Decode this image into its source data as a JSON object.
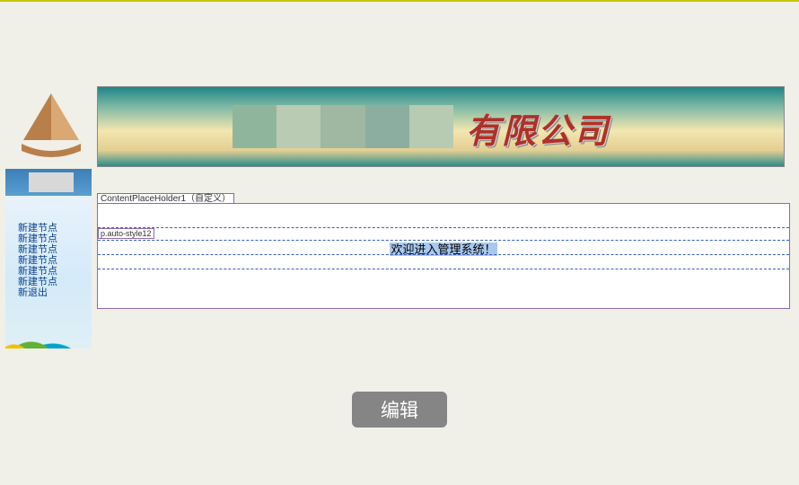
{
  "banner": {
    "company_suffix": "有限公司"
  },
  "sidebar": {
    "items": [
      {
        "label": "新建节点"
      },
      {
        "label": "新建节点"
      },
      {
        "label": "新建节点"
      },
      {
        "label": "新建节点"
      },
      {
        "label": "新建节点"
      },
      {
        "label": "新建节点"
      },
      {
        "label": "新退出"
      }
    ]
  },
  "designer": {
    "placeholder_tag": "ContentPlaceHolder1（自定义）",
    "inner_tag": "p.auto-style12",
    "welcome_text": "欢迎进入管理系统！"
  },
  "actions": {
    "edit_label": "编辑"
  }
}
